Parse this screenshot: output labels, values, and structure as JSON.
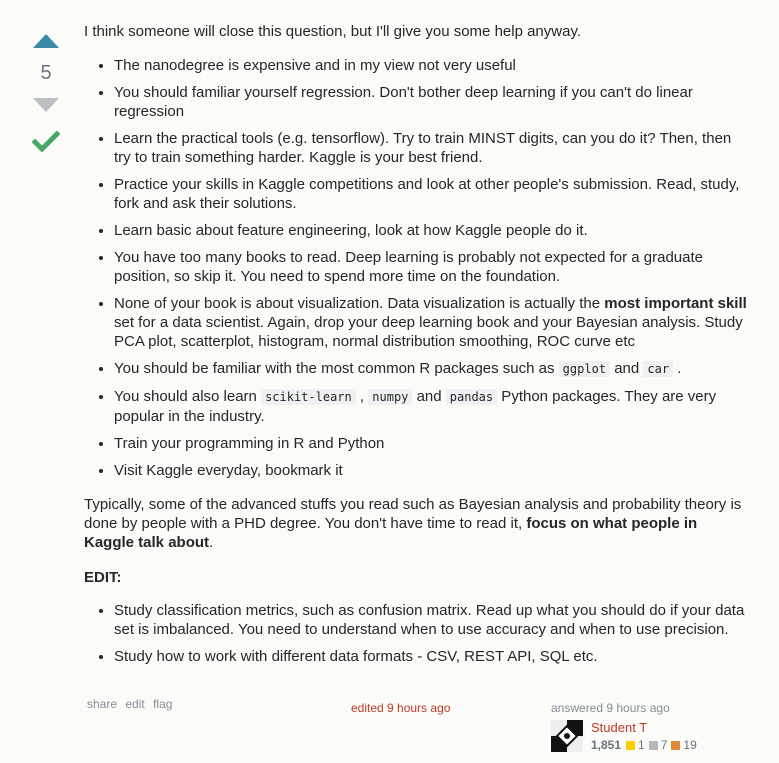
{
  "votes": {
    "count": "5"
  },
  "intro": "I think someone will close this question, but I'll give you some help anyway.",
  "list1": [
    {
      "text": "The nanodegree is expensive and in my view not very useful"
    },
    {
      "text": "You should familiar yourself regression. Don't bother deep learning if you can't do linear regression"
    },
    {
      "text": "Learn the practical tools (e.g. tensorflow). Try to train MINST digits, can you do it? Then, then try to train something harder. Kaggle is your best friend."
    },
    {
      "text": "Practice your skills in Kaggle competitions and look at other people's submission. Read, study, fork and ask their solutions."
    },
    {
      "text": "Learn basic about feature engineering, look at how Kaggle people do it."
    },
    {
      "text": "You have too many books to read. Deep learning is probably not expected for a graduate position, so skip it. You need to spend more time on the foundation."
    },
    {
      "pre": "None of your book is about visualization. Data visualization is actually the ",
      "bold": "most important skill",
      "post": " set for a data scientist. Again, drop your deep learning book and your Bayesian analysis. Study PCA plot, scatterplot, histogram, normal distribution smoothing, ROC curve etc"
    },
    {
      "pre": "You should be familiar with the most common R packages such as ",
      "code1": "ggplot",
      "mid": " and ",
      "code2": "car",
      "post": " ."
    },
    {
      "pre": "You should also learn ",
      "code1": "scikit-learn",
      "mid1": " , ",
      "code2": "numpy",
      "mid2": " and ",
      "code3": "pandas",
      "post": " Python packages. They are very popular in the industry."
    },
    {
      "text": "Train your programming in R and Python"
    },
    {
      "text": "Visit Kaggle everyday, bookmark it"
    }
  ],
  "paragraph": {
    "pre": "Typically, some of the advanced stuffs you read such as Bayesian analysis and probability theory is done by people with a PHD degree. You don't have time to read it, ",
    "bold": "focus on what people in Kaggle talk about",
    "post": "."
  },
  "edit_heading": "EDIT:",
  "list2": [
    {
      "text": "Study classification metrics, such as confusion matrix. Read up what you should do if your data set is imbalanced. You need to understand when to use accuracy and when to use precision."
    },
    {
      "text": "Study how to work with different data formats - CSV, REST API, SQL etc."
    }
  ],
  "menu": {
    "share": "share",
    "edit": "edit",
    "flag": "flag"
  },
  "edited": "edited 9 hours ago",
  "answered": "answered 9 hours ago",
  "user": {
    "name": "Student T",
    "reputation": "1,851",
    "gold": "1",
    "silver": "7",
    "bronze": "19"
  },
  "colors": {
    "upvote": "#3a8aa3",
    "accept": "#48a868",
    "link_red": "#c0392b",
    "gold": "#ffcc01",
    "silver": "#b4b8bc",
    "bronze": "#e08938"
  }
}
